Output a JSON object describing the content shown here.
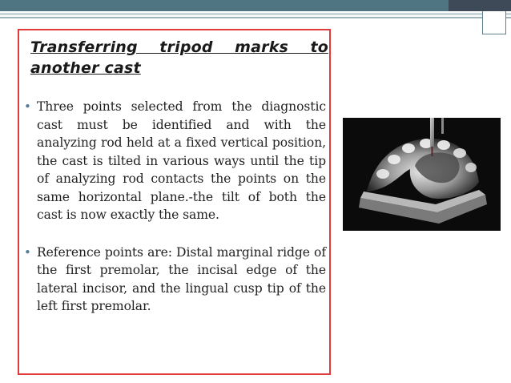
{
  "slide": {
    "title": "Transferring tripod marks to another cast",
    "bullets": [
      "Three points selected from the diagnostic cast must be identified and with the analyzing rod held at a fixed vertical position, the cast is tilted in various ways until the tip of analyzing rod contacts the points on the same horizontal plane.-the tilt of both the cast is now exactly the same.",
      "Reference points are: Distal marginal ridge of the first premolar, the incisal edge of the lateral incisor, and the lingual cusp tip of the left first premolar."
    ]
  },
  "colors": {
    "header_bar": "#4f7482",
    "header_dark": "#3e4a57",
    "box_border": "#e03a3a",
    "bullet_marker": "#4f7fa0"
  }
}
